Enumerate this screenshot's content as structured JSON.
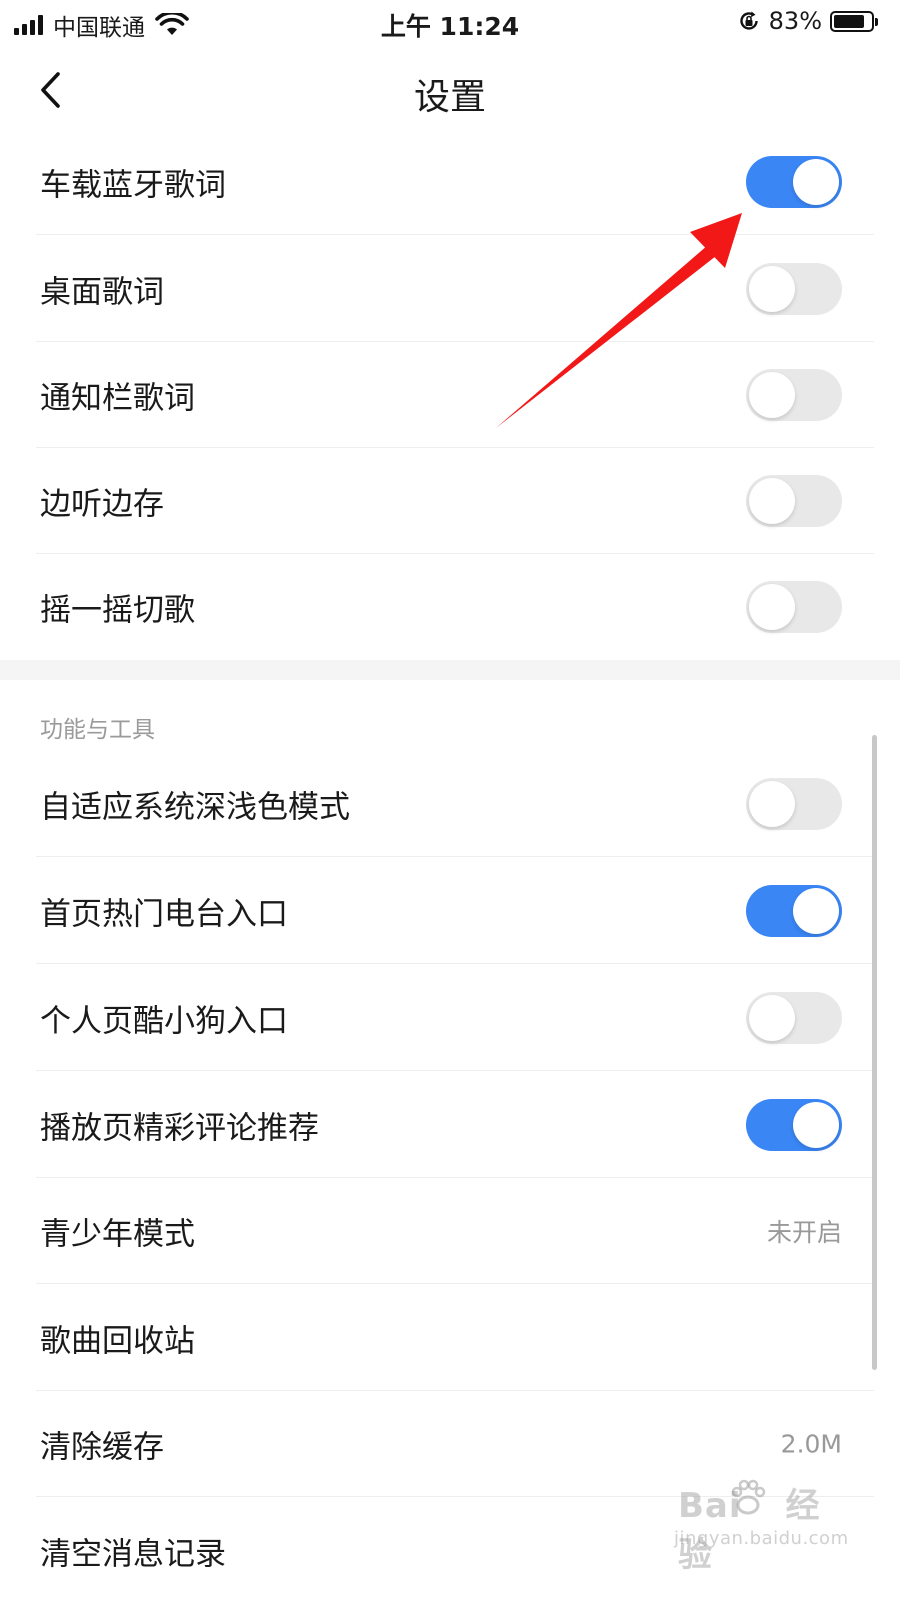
{
  "status_bar": {
    "carrier": "中国联通",
    "time": "上午 11:24",
    "battery_percent_text": "83%",
    "battery_level": 0.83
  },
  "nav": {
    "title": "设置"
  },
  "settings_top": [
    {
      "label": "车载蓝牙歌词",
      "toggle": true
    },
    {
      "label": "桌面歌词",
      "toggle": false
    },
    {
      "label": "通知栏歌词",
      "toggle": false
    },
    {
      "label": "边听边存",
      "toggle": false
    },
    {
      "label": "摇一摇切歌",
      "toggle": false
    }
  ],
  "section_tools": {
    "header": "功能与工具",
    "items": [
      {
        "label": "自适应系统深浅色模式",
        "toggle": false
      },
      {
        "label": "首页热门电台入口",
        "toggle": true
      },
      {
        "label": "个人页酷小狗入口",
        "toggle": false
      },
      {
        "label": "播放页精彩评论推荐",
        "toggle": true
      },
      {
        "label": "青少年模式",
        "value": "未开启"
      },
      {
        "label": "歌曲回收站"
      },
      {
        "label": "清除缓存",
        "value": "2.0M"
      },
      {
        "label": "清空消息记录"
      }
    ]
  },
  "watermark": {
    "brand": "Bai",
    "brand_suffix": "经验",
    "url": "jingyan.baidu.com"
  },
  "colors": {
    "toggle_on": "#3a86f5",
    "toggle_off": "#e8e8e8",
    "annotation_arrow": "#f21818"
  }
}
